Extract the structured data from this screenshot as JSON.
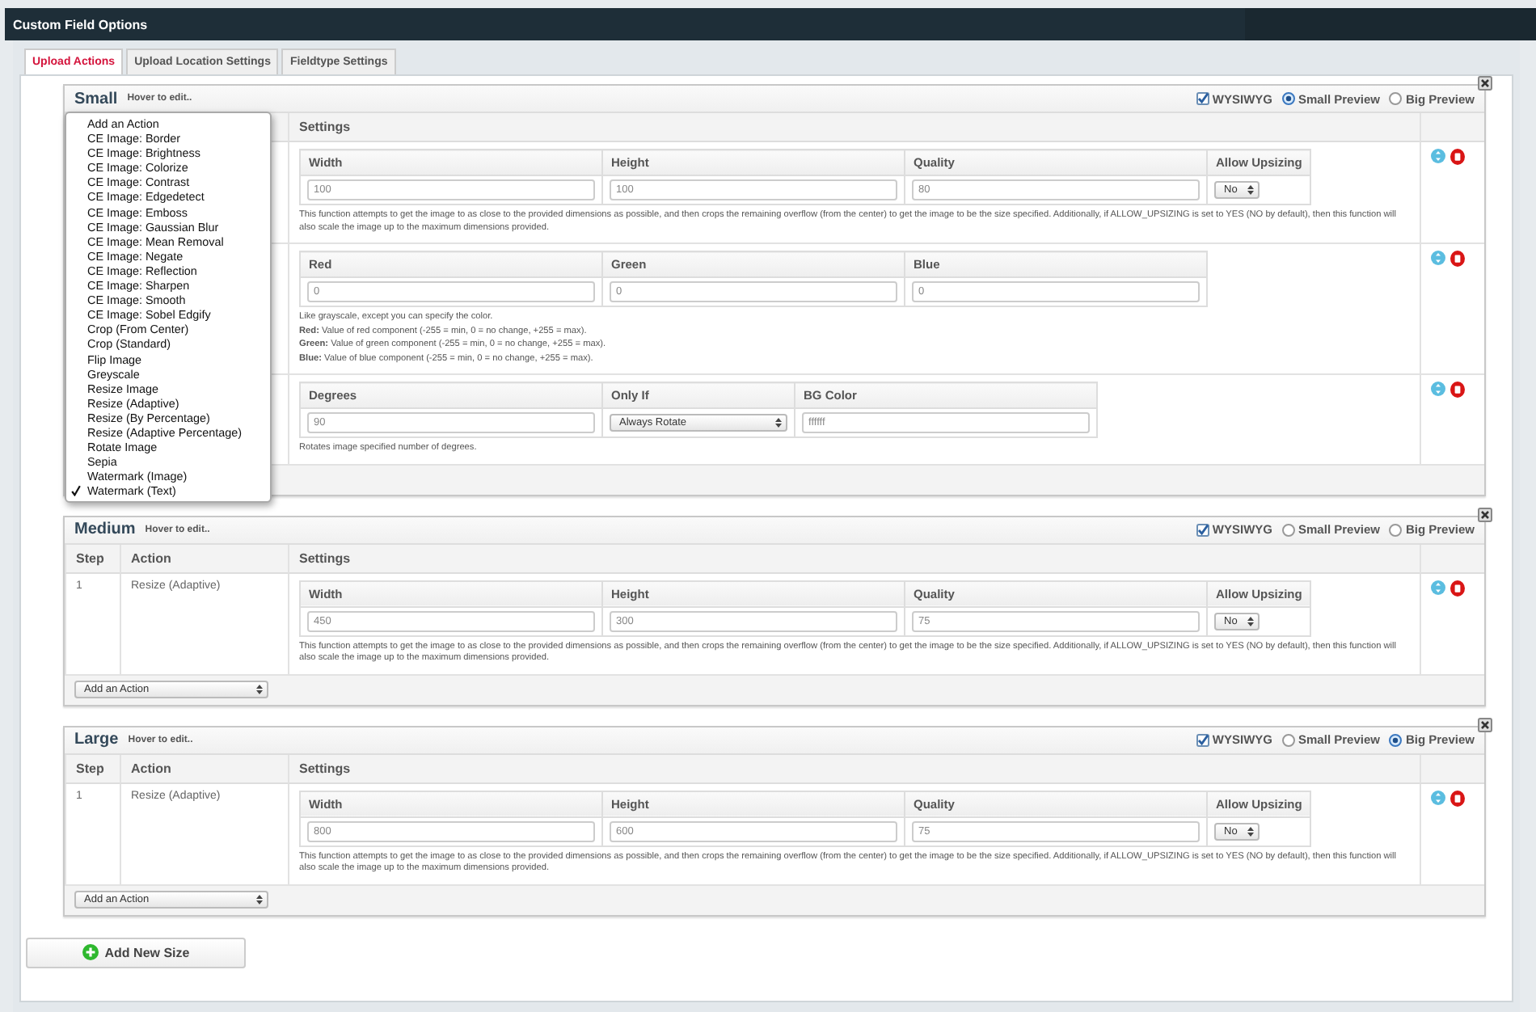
{
  "header": {
    "title": "Custom Field Options"
  },
  "tabs": [
    {
      "label": "Upload Actions",
      "selected": true
    },
    {
      "label": "Upload Location Settings",
      "selected": false
    },
    {
      "label": "Fieldtype Settings",
      "selected": false
    }
  ],
  "sizes": [
    {
      "name": "Small",
      "hint": "Hover to edit..",
      "options": [
        {
          "kind": "checkbox",
          "label": "WYSIWYG",
          "checked": true
        },
        {
          "kind": "radio",
          "label": "Small Preview",
          "selected": true
        },
        {
          "kind": "radio",
          "label": "Big Preview",
          "selected": false
        }
      ],
      "columns": {
        "settings": "Settings"
      },
      "steps": [
        {
          "fields": [
            {
              "kind": "text",
              "label": "Width",
              "value": "100"
            },
            {
              "kind": "text",
              "label": "Height",
              "value": "100"
            },
            {
              "kind": "text",
              "label": "Quality",
              "value": "80"
            },
            {
              "kind": "select",
              "label": "Allow Upsizing",
              "value": "No"
            }
          ],
          "description": [
            "This function attempts to get the image to as close to the provided dimensions as possible, and then crops the remaining overflow (from the center) to get the image to be the size specified. Additionally, if ALLOW_UPSIZING is set to YES (NO by default), then this function will also scale the image up to the maximum dimensions provided."
          ]
        },
        {
          "fields": [
            {
              "kind": "text",
              "label": "Red",
              "value": "0"
            },
            {
              "kind": "text",
              "label": "Green",
              "value": "0"
            },
            {
              "kind": "text",
              "label": "Blue",
              "value": "0"
            }
          ],
          "description": [
            "Like grayscale, except you can specify the color.",
            "**Red:** Value of red component (-255 = min, 0 = no change, +255 = max).",
            "**Green:** Value of green component (-255 = min, 0 = no change, +255 = max).",
            "**Blue:** Value of blue component (-255 = min, 0 = no change, +255 = max)."
          ]
        },
        {
          "fields": [
            {
              "kind": "text",
              "label": "Degrees",
              "value": "90"
            },
            {
              "kind": "select",
              "label": "Only If",
              "value": "Always Rotate"
            },
            {
              "kind": "text",
              "label": "BG Color",
              "value": "ffffff"
            }
          ],
          "description": [
            "Rotates image specified number of degrees."
          ]
        }
      ],
      "menu": {
        "items": [
          {
            "label": "Add an Action",
            "selected": false
          },
          {
            "label": "CE Image: Border",
            "selected": false
          },
          {
            "label": "CE Image: Brightness",
            "selected": false
          },
          {
            "label": "CE Image: Colorize",
            "selected": false
          },
          {
            "label": "CE Image: Contrast",
            "selected": false
          },
          {
            "label": "CE Image: Edgedetect",
            "selected": false
          },
          {
            "label": "CE Image: Emboss",
            "selected": false
          },
          {
            "label": "CE Image: Gaussian Blur",
            "selected": false
          },
          {
            "label": "CE Image: Mean Removal",
            "selected": false
          },
          {
            "label": "CE Image: Negate",
            "selected": false
          },
          {
            "label": "CE Image: Reflection",
            "selected": false
          },
          {
            "label": "CE Image: Sharpen",
            "selected": false
          },
          {
            "label": "CE Image: Smooth",
            "selected": false
          },
          {
            "label": "CE Image: Sobel Edgify",
            "selected": false
          },
          {
            "label": "Crop (From Center)",
            "selected": false
          },
          {
            "label": "Crop (Standard)",
            "selected": false
          },
          {
            "label": "Flip Image",
            "selected": false
          },
          {
            "label": "Greyscale",
            "selected": false
          },
          {
            "label": "Resize Image",
            "selected": false
          },
          {
            "label": "Resize (Adaptive)",
            "selected": false
          },
          {
            "label": "Resize (By Percentage)",
            "selected": false
          },
          {
            "label": "Resize (Adaptive Percentage)",
            "selected": false
          },
          {
            "label": "Rotate Image",
            "selected": false
          },
          {
            "label": "Sepia",
            "selected": false
          },
          {
            "label": "Watermark (Image)",
            "selected": false
          },
          {
            "label": "Watermark (Text)",
            "selected": true
          }
        ]
      }
    },
    {
      "name": "Medium",
      "hint": "Hover to edit..",
      "options": [
        {
          "kind": "checkbox",
          "label": "WYSIWYG",
          "checked": true
        },
        {
          "kind": "radio",
          "label": "Small Preview",
          "selected": false
        },
        {
          "kind": "radio",
          "label": "Big Preview",
          "selected": false
        }
      ],
      "columns": {
        "step": "Step",
        "action": "Action",
        "settings": "Settings"
      },
      "steps": [
        {
          "step": "1",
          "action": "Resize (Adaptive)",
          "fields": [
            {
              "kind": "text",
              "label": "Width",
              "value": "450"
            },
            {
              "kind": "text",
              "label": "Height",
              "value": "300"
            },
            {
              "kind": "text",
              "label": "Quality",
              "value": "75"
            },
            {
              "kind": "select",
              "label": "Allow Upsizing",
              "value": "No"
            }
          ],
          "description": [
            "This function attempts to get the image to as close to the provided dimensions as possible, and then crops the remaining overflow (from the center) to get the image to be the size specified. Additionally, if ALLOW_UPSIZING is set to YES (NO by default), then this function will also scale the image up to the maximum dimensions provided."
          ]
        }
      ],
      "add_action": "Add an Action"
    },
    {
      "name": "Large",
      "hint": "Hover to edit..",
      "options": [
        {
          "kind": "checkbox",
          "label": "WYSIWYG",
          "checked": true
        },
        {
          "kind": "radio",
          "label": "Small Preview",
          "selected": false
        },
        {
          "kind": "radio",
          "label": "Big Preview",
          "selected": true
        }
      ],
      "columns": {
        "step": "Step",
        "action": "Action",
        "settings": "Settings"
      },
      "steps": [
        {
          "step": "1",
          "action": "Resize (Adaptive)",
          "fields": [
            {
              "kind": "text",
              "label": "Width",
              "value": "800"
            },
            {
              "kind": "text",
              "label": "Height",
              "value": "600"
            },
            {
              "kind": "text",
              "label": "Quality",
              "value": "75"
            },
            {
              "kind": "select",
              "label": "Allow Upsizing",
              "value": "No"
            }
          ],
          "description": [
            "This function attempts to get the image to as close to the provided dimensions as possible, and then crops the remaining overflow (from the center) to get the image to be the size specified. Additionally, if ALLOW_UPSIZING is set to YES (NO by default), then this function will also scale the image up to the maximum dimensions provided."
          ]
        }
      ],
      "add_action": "Add an Action"
    }
  ],
  "add_size_button": "Add New Size"
}
